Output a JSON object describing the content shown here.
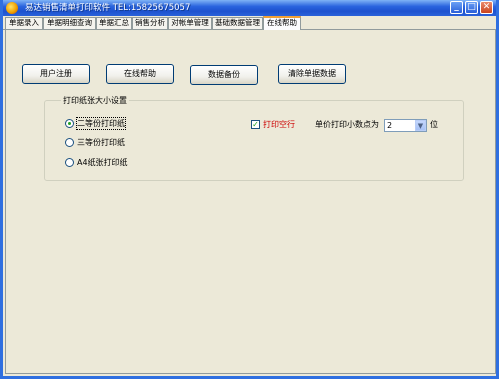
{
  "window": {
    "title": "易达销售清单打印软件 TEL:15825675057",
    "minimize": "_",
    "maximize": "□",
    "close": "✕"
  },
  "tabs": [
    {
      "label": "单据录入"
    },
    {
      "label": "单据明细查询"
    },
    {
      "label": "单据汇总"
    },
    {
      "label": "销售分析"
    },
    {
      "label": "对帐单管理"
    },
    {
      "label": "基础数据管理"
    },
    {
      "label": "在线帮助",
      "active": true
    }
  ],
  "buttons": {
    "register": "用户注册",
    "online_help": "在线帮助",
    "backup": "数据备份",
    "clear": "清除单据数据"
  },
  "paper_group": {
    "title": "打印纸张大小设置",
    "options": [
      {
        "label": "二等份打印纸",
        "checked": true
      },
      {
        "label": "三等份打印纸",
        "checked": false
      },
      {
        "label": "A4纸张打印纸",
        "checked": false
      }
    ],
    "print_blank_row": {
      "label": "打印空行",
      "checked": true,
      "color": "#cc0000"
    },
    "decimal_label": "单价打印小数点为",
    "decimal_value": "2",
    "decimal_unit": "位"
  }
}
